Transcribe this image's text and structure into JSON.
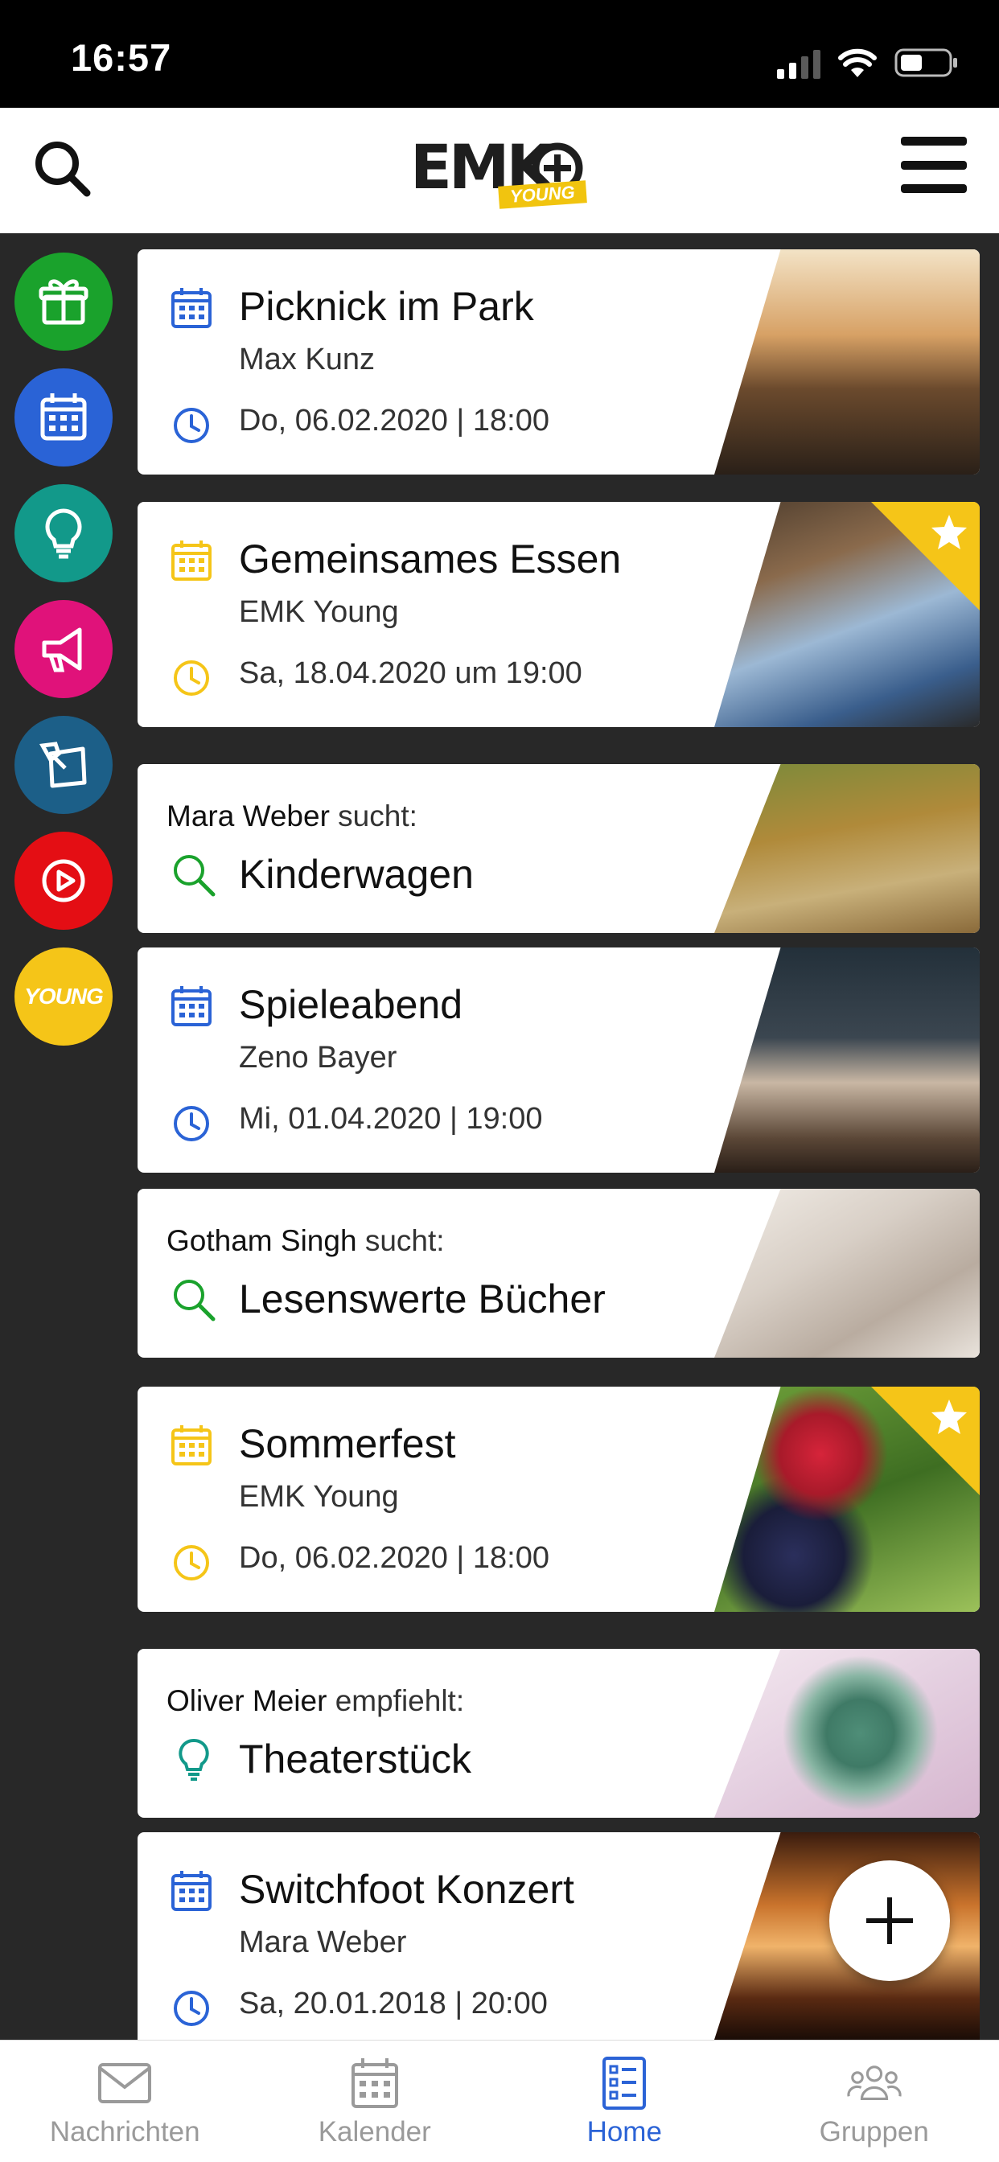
{
  "status": {
    "time": "16:57"
  },
  "header": {
    "logo_text": "EMK",
    "logo_badge": "YOUNG"
  },
  "rail": [
    {
      "name": "gift",
      "color": "#1aa22c"
    },
    {
      "name": "calendar",
      "color": "#2a63d6"
    },
    {
      "name": "lightbulb",
      "color": "#12998a"
    },
    {
      "name": "megaphone",
      "color": "#e0127a"
    },
    {
      "name": "note",
      "color": "#1c5f88"
    },
    {
      "name": "play",
      "color": "#e40e14"
    },
    {
      "name": "young",
      "color": "#f5c518",
      "label": "YOUNG"
    }
  ],
  "cards": [
    {
      "type": "event",
      "title": "Picknick im Park",
      "subtitle": "Max Kunz",
      "date": "Do, 06.02.2020 | 18:00",
      "accent": "#2a63d6",
      "starred": false
    },
    {
      "type": "event",
      "title": "Gemeinsames Essen",
      "subtitle": "EMK Young",
      "date": "Sa, 18.04.2020 um 19:00",
      "accent": "#f5c518",
      "starred": true
    },
    {
      "type": "search",
      "person": "Mara Weber",
      "verb": "sucht:",
      "title": "Kinderwagen",
      "accent": "#1aa22c"
    },
    {
      "type": "event",
      "title": "Spieleabend",
      "subtitle": "Zeno Bayer",
      "date": "Mi, 01.04.2020 | 19:00",
      "accent": "#2a63d6",
      "starred": false
    },
    {
      "type": "search",
      "person": "Gotham Singh",
      "verb": "sucht:",
      "title": "Lesenswerte Bücher",
      "accent": "#1aa22c"
    },
    {
      "type": "event",
      "title": "Sommerfest",
      "subtitle": "EMK Young",
      "date": "Do, 06.02.2020 | 18:00",
      "accent": "#f5c518",
      "starred": true
    },
    {
      "type": "recommend",
      "person": "Oliver Meier",
      "verb": "empfiehlt:",
      "title": "Theaterstück",
      "accent": "#12998a"
    },
    {
      "type": "event",
      "title": "Switchfoot Konzert",
      "subtitle": "Mara Weber",
      "date": "Sa, 20.01.2018 | 20:00",
      "accent": "#2a63d6",
      "starred": false
    }
  ],
  "tabs": [
    {
      "label": "Nachrichten",
      "icon": "mail-icon",
      "active": false
    },
    {
      "label": "Kalender",
      "icon": "calendar-icon",
      "active": false
    },
    {
      "label": "Home",
      "icon": "home-list-icon",
      "active": true
    },
    {
      "label": "Gruppen",
      "icon": "groups-icon",
      "active": false
    }
  ]
}
